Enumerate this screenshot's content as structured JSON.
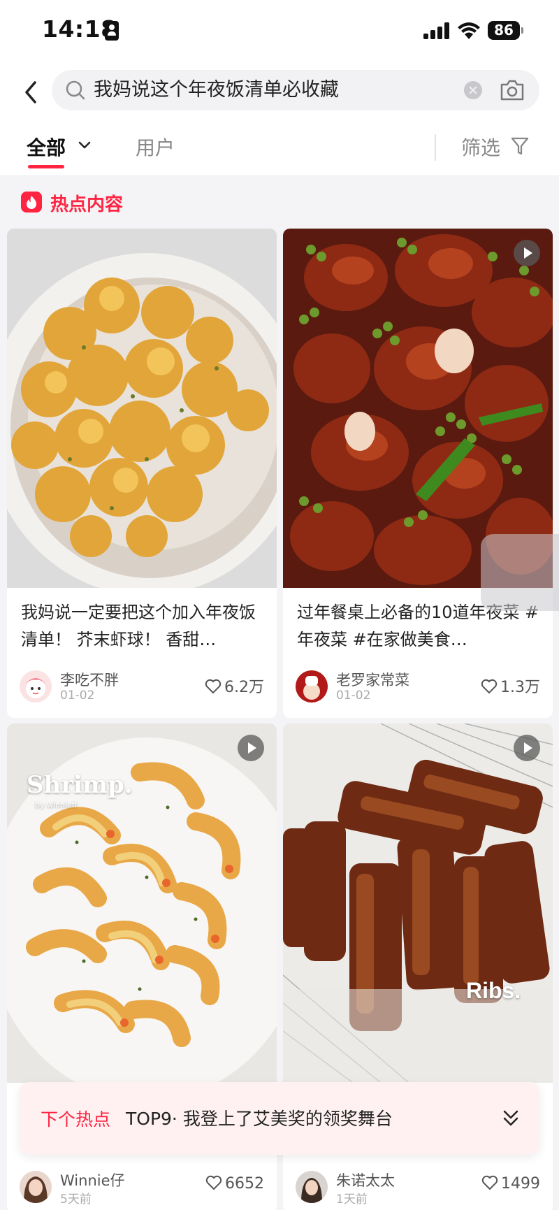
{
  "status_bar": {
    "time": "14:18",
    "battery": "86"
  },
  "search": {
    "query": "我妈说这个年夜饭清单必收藏"
  },
  "tabs": {
    "all": "全部",
    "users": "用户",
    "filter": "筛选"
  },
  "section": {
    "hot_label": "热点内容"
  },
  "cards": [
    {
      "title": "我妈说一定要把这个加入年夜饭清单！ 芥末虾球！ 香甜…",
      "author": "李吃不胖",
      "date": "01-02",
      "likes": "6.2万"
    },
    {
      "title": "过年餐桌上必备的10道年夜菜 #年夜菜 #在家做美食…",
      "author": "老罗家常菜",
      "date": "01-02",
      "likes": "1.3万"
    },
    {
      "caption": "Shrimp.",
      "caption_sub": "by winnieff",
      "author": "Winnie仔",
      "date": "5天前",
      "likes": "6652"
    },
    {
      "caption": "Ribs.",
      "author": "朱诺太太",
      "date": "1天前",
      "likes": "1499"
    }
  ],
  "next_hot": {
    "label": "下个热点",
    "text": "TOP9· 我登上了艾美奖的领奖舞台"
  },
  "colors": {
    "accent": "#ff2442"
  },
  "icons": [
    "back-icon",
    "search-icon",
    "clear-icon",
    "camera-icon",
    "chevron-down-icon",
    "filter-icon",
    "fire-icon",
    "heart-icon",
    "play-icon",
    "chevron-double-down-icon"
  ]
}
